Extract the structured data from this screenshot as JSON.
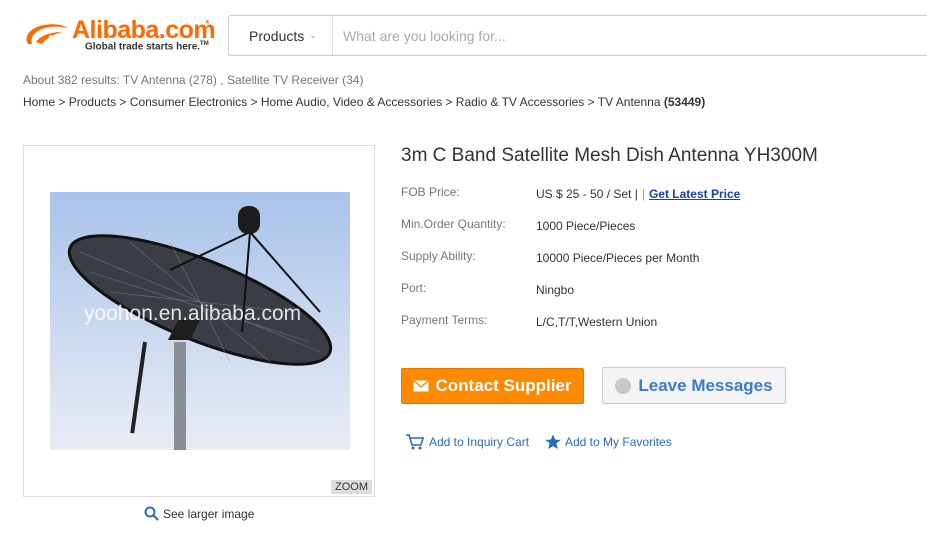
{
  "header": {
    "logo": {
      "wordmark": "Alibaba.com",
      "star": "*",
      "tagline": "Global trade starts here.",
      "tm": "TM"
    },
    "search": {
      "category": "Products",
      "placeholder": "What are you looking for..."
    }
  },
  "results": {
    "prefix": "About 382 results:",
    "links": [
      "TV Antenna (278)",
      "Satellite TV Receiver (34)"
    ],
    "separator": ","
  },
  "breadcrumb": {
    "items": [
      "Home",
      "Products",
      "Consumer Electronics",
      "Home Audio, Video & Accessories",
      "Radio & TV Accessories",
      "TV Antenna"
    ],
    "separator": ">",
    "count": "(53449)"
  },
  "product": {
    "title": "3m C Band Satellite Mesh Dish Antenna YH300M",
    "image": {
      "watermark": "yoohon.en.alibaba.com",
      "zoom": "ZOOM",
      "see_larger": "See larger image"
    },
    "specs": {
      "fob_label": "FOB Price:",
      "fob_value": "US $ 25 - 50 / Set |",
      "fob_sep": "|",
      "fob_link": "Get Latest Price",
      "moq_label": "Min.Order Quantity:",
      "moq_value": "1000 Piece/Pieces",
      "supply_label": "Supply Ability:",
      "supply_value": "10000 Piece/Pieces per Month",
      "port_label": "Port:",
      "port_value": "Ningbo",
      "payment_label": "Payment Terms:",
      "payment_value": "L/C,T/T,Western Union"
    },
    "buttons": {
      "contact": "Contact Supplier",
      "leave": "Leave Messages"
    },
    "actions": {
      "inquiry": "Add to Inquiry Cart",
      "favorites": "Add to My Favorites"
    }
  },
  "colors": {
    "brand": "#ff6a00",
    "contact_button": "#ff8a00",
    "link": "#2b6cb8",
    "latest_price": "#1a3fa5"
  },
  "icons": [
    "alibaba-logo-icon",
    "chevron-down-icon",
    "magnifier-icon",
    "envelope-icon",
    "chat-bubble-icon",
    "cart-icon",
    "star-icon"
  ]
}
